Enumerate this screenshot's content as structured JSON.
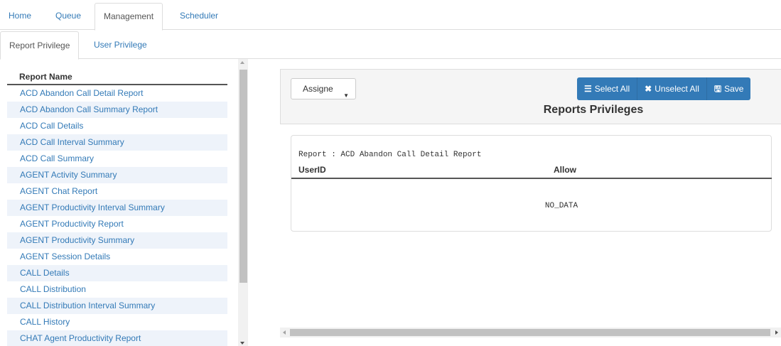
{
  "top_tabs": [
    "Home",
    "Queue",
    "Management",
    "Scheduler"
  ],
  "sub_tabs": [
    "Report Privilege",
    "User Privilege"
  ],
  "report_list": {
    "header": "Report Name",
    "items": [
      "ACD Abandon Call Detail Report",
      "ACD Abandon Call Summary Report",
      "ACD Call Details",
      "ACD Call Interval Summary",
      "ACD Call Summary",
      "AGENT Activity Summary",
      "AGENT Chat Report",
      "AGENT Productivity Interval Summary",
      "AGENT Productivity Report",
      "AGENT Productivity Summary",
      "AGENT Session Details",
      "CALL Details",
      "CALL Distribution",
      "CALL Distribution Interval Summary",
      "CALL History",
      "CHAT Agent Productivity Report"
    ]
  },
  "panel": {
    "select_value": "Assigne",
    "select_all_label": "Select All",
    "unselect_all_label": "Unselect All",
    "save_label": "Save",
    "title": "Reports Privileges"
  },
  "result": {
    "report_caption": "Report : ACD Abandon Call Detail Report",
    "col_userid": "UserID",
    "col_allow": "Allow",
    "empty_text": "NO_DATA"
  },
  "icons": {
    "list": "list-icon",
    "cross": "cross-icon",
    "save": "floppy-icon"
  },
  "colors": {
    "accent": "#337ab7",
    "row_alt": "#eef3fa"
  }
}
